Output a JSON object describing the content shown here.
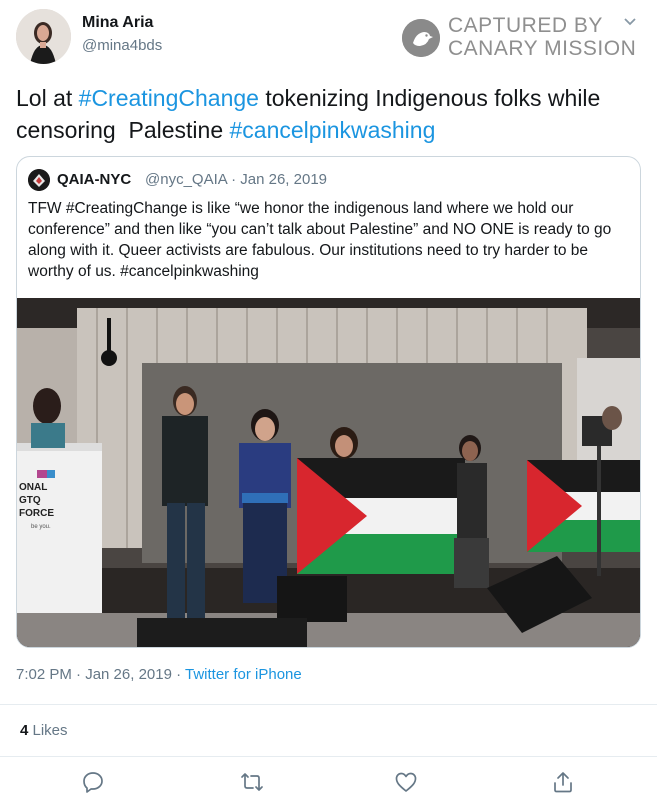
{
  "author": {
    "name": "Mina Aria",
    "handle": "@mina4bds"
  },
  "watermark": {
    "line1": "CAPTURED BY",
    "line2": "CANARY MISSION"
  },
  "tweet": {
    "text_parts": [
      {
        "type": "text",
        "value": "Lol at "
      },
      {
        "type": "hashtag",
        "value": "#CreatingChange"
      },
      {
        "type": "text",
        "value": " tokenizing Indigenous folks while censoring  Palestine "
      },
      {
        "type": "hashtag",
        "value": "#cancelpinkwashing"
      }
    ]
  },
  "quoted": {
    "name": "QAIA-NYC",
    "handle_date": "@nyc_QAIA · Jan 26, 2019",
    "text": "TFW #CreatingChange is like “we honor the indigenous land where we hold our conference” and then like “you can’t talk about Palestine” and NO ONE is ready to go along with it. Queer activists are fabulous. Our institutions need to try harder to be worthy of us. #cancelpinkwashing",
    "photo": {
      "podium_sign_lines": [
        "ONAL",
        "GTQ",
        "FORCE",
        "be you."
      ],
      "flag_colors": {
        "black": "#1a1a1a",
        "white": "#f2f2f2",
        "green": "#1f9a4a",
        "red": "#d8262e"
      }
    }
  },
  "meta": {
    "time_date": "7:02 PM · Jan 26, 2019 · ",
    "source": "Twitter for iPhone"
  },
  "likes": {
    "count": "4",
    "label": " Likes"
  },
  "actions": [
    "reply-icon",
    "retweet-icon",
    "like-icon",
    "share-icon"
  ],
  "colors": {
    "link": "#1b95e0",
    "secondary_text": "#657786",
    "border": "#ccd6dd"
  }
}
